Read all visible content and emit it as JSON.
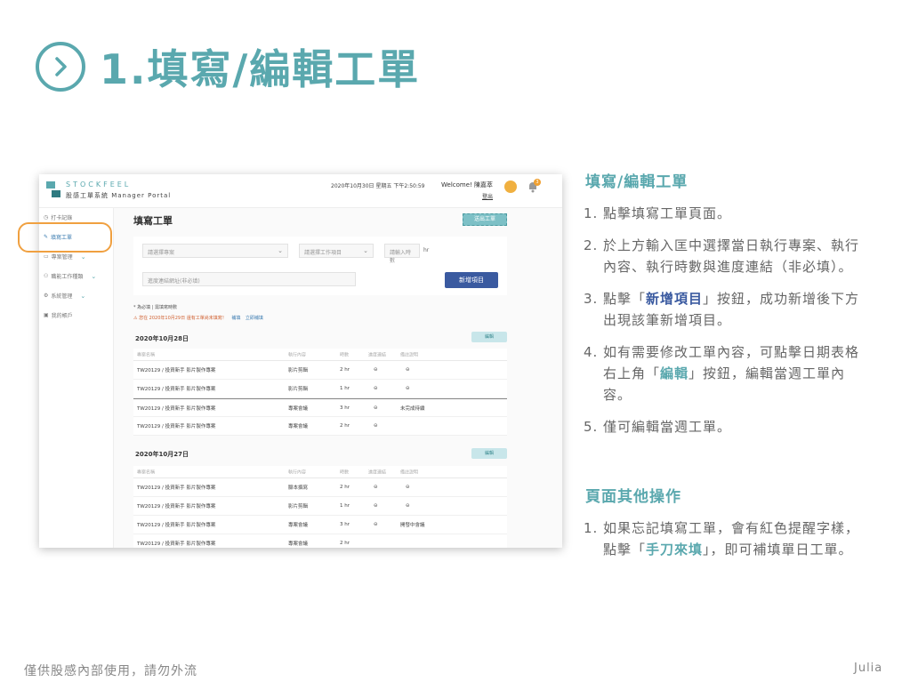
{
  "slide": {
    "title": "1.填寫/編輯工單",
    "footer_left": "僅供股感內部使用，請勿外流",
    "footer_right": "Julia"
  },
  "app": {
    "brand": "STOCKFEEL",
    "subtitle": "股感工單系統 Manager Portal",
    "datetime": "2020年10月30日 星期五 下午2:50:59",
    "welcome": "Welcome! 陳嘉萃",
    "logout": "登出",
    "notification_count": "3",
    "sidebar": [
      {
        "label": "打卡記錄",
        "icon": "clock-icon",
        "caret": false
      },
      {
        "label": "填寫工單",
        "icon": "pencil-icon",
        "caret": false
      },
      {
        "label": "專案管理",
        "icon": "folder-icon",
        "caret": true
      },
      {
        "label": "職能工作種類",
        "icon": "users-icon",
        "caret": true
      },
      {
        "label": "系統管理",
        "icon": "gear-icon",
        "caret": true
      },
      {
        "label": "我的帳戶",
        "icon": "account-icon",
        "caret": false
      }
    ],
    "page_heading": "填寫工單",
    "submit_label": "送出工單",
    "form": {
      "project_placeholder": "請選擇專案",
      "work_item_placeholder": "請選擇工作項目",
      "hours_placeholder": "請輸入時數",
      "hours_unit": "hr",
      "progress_placeholder": "進度連結網址(非必填)",
      "add_button": "新增項目"
    },
    "notes": {
      "required": "* 為必填 | 需填寫時數",
      "reminder": "您在 2020年10月29日 還有工單尚未填寫！",
      "reminder_action1": "補填",
      "reminder_action2": "立即補填"
    },
    "table_headers": [
      "專案名稱",
      "執行內容",
      "時數",
      "進度連結",
      "備註說明"
    ],
    "days": [
      {
        "date": "2020年10月28日",
        "edit_label": "編輯",
        "rows": [
          {
            "project": "TW20129 / 投資新手 影片製作專案",
            "task": "影片剪輯",
            "hours": "2 hr",
            "link": "⊝",
            "note": "⊝"
          },
          {
            "project": "TW20129 / 投資新手 影片製作專案",
            "task": "影片剪輯",
            "hours": "1 hr",
            "link": "⊝",
            "note": "⊝"
          },
          {
            "project": "TW20129 / 投資新手 影片製作專案",
            "task": "專案會議",
            "hours": "3 hr",
            "link": "⊝",
            "note": "未完成待續"
          },
          {
            "project": "TW20129 / 投資新手 影片製作專案",
            "task": "專案會議",
            "hours": "2 hr",
            "link": "⊝",
            "note": ""
          }
        ]
      },
      {
        "date": "2020年10月27日",
        "edit_label": "編輯",
        "rows": [
          {
            "project": "TW20129 / 投資新手 影片製作專案",
            "task": "腳本撰寫",
            "hours": "2 hr",
            "link": "⊝",
            "note": "⊝"
          },
          {
            "project": "TW20129 / 投資新手 影片製作專案",
            "task": "影片剪輯",
            "hours": "1 hr",
            "link": "⊝",
            "note": "⊝"
          },
          {
            "project": "TW20129 / 投資新手 影片製作專案",
            "task": "專案會議",
            "hours": "3 hr",
            "link": "⊝",
            "note": "開發中會議"
          },
          {
            "project": "TW20129 / 投資新手 影片製作專案",
            "task": "專案會議",
            "hours": "2 hr",
            "link": "⊝",
            "note": ""
          }
        ]
      }
    ]
  },
  "instructions": {
    "section1_title": "填寫/編輯工單",
    "steps": [
      {
        "num": "1.",
        "line1": "點擊填寫工單頁面。"
      },
      {
        "num": "2.",
        "line1": "於上方輸入匡中選擇當日執行專案、執行",
        "line2": "內容、執行時數與進度連結（非必填）。"
      },
      {
        "num": "3.",
        "pre": "點擊「",
        "hl": "新增項目",
        "post": "」按鈕，成功新增後下方",
        "line2": "出現該筆新增項目。"
      },
      {
        "num": "4.",
        "line1": "如有需要修改工單內容，可點擊日期表格",
        "pre2": "右上角「",
        "hl2": "編輯",
        "post2": "」按鈕，編輯當週工單內",
        "line3": "容。"
      },
      {
        "num": "5.",
        "line1": "僅可編輯當週工單。"
      }
    ],
    "section2_title": "頁面其他操作",
    "other": {
      "num": "1.",
      "line1": "如果忘記填寫工單，會有紅色提醒字樣，",
      "pre2": "點擊「",
      "hl2": "手刀來填",
      "post2": "」，即可補填單日工單。"
    }
  }
}
